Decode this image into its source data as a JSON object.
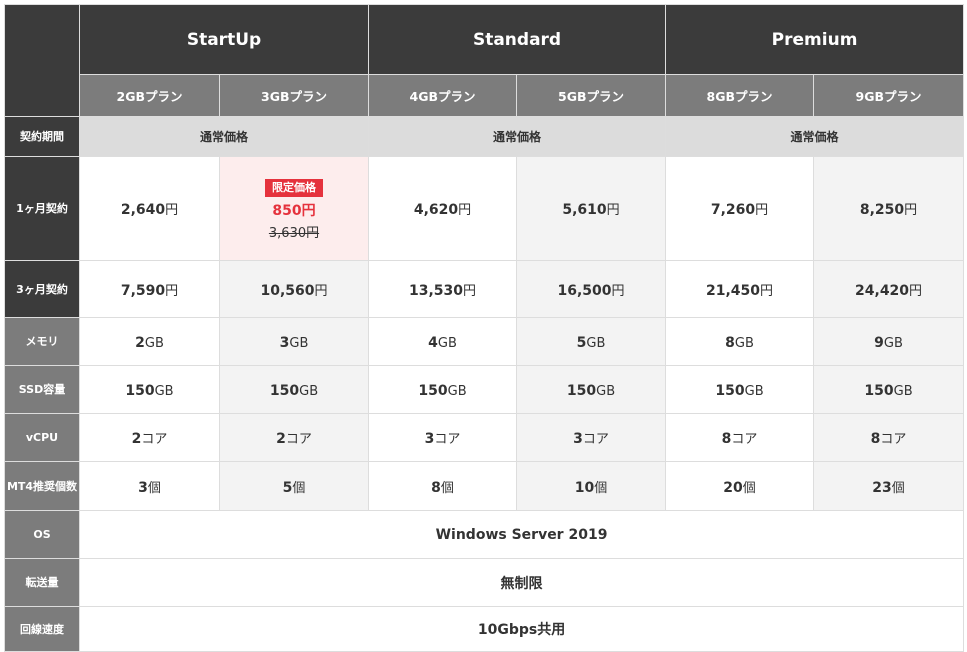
{
  "tiers": [
    "StartUp",
    "Standard",
    "Premium"
  ],
  "plans": [
    "2GBプラン",
    "3GBプラン",
    "4GBプラン",
    "5GBプラン",
    "8GBプラン",
    "9GBプラン"
  ],
  "labels": {
    "contract": "契約期間",
    "one_month": "1ヶ月契約",
    "three_month": "3ヶ月契約",
    "memory": "メモリ",
    "ssd": "SSD容量",
    "vcpu": "vCPU",
    "mt4": "MT4推奨個数",
    "os": "OS",
    "transfer": "転送量",
    "line_speed": "回線速度"
  },
  "normal_price_label": "通常価格",
  "currency": "円",
  "one_month": [
    "2,640",
    "850",
    "4,620",
    "5,610",
    "7,260",
    "8,250"
  ],
  "promo": {
    "badge": "限定価格",
    "old_price": "3,630円"
  },
  "three_month": [
    "7,590",
    "10,560",
    "13,530",
    "16,500",
    "21,450",
    "24,420"
  ],
  "memory": {
    "values": [
      "2",
      "3",
      "4",
      "5",
      "8",
      "9"
    ],
    "unit": "GB"
  },
  "ssd": {
    "values": [
      "150",
      "150",
      "150",
      "150",
      "150",
      "150"
    ],
    "unit": "GB"
  },
  "vcpu": {
    "values": [
      "2",
      "2",
      "3",
      "3",
      "8",
      "8"
    ],
    "unit": "コア"
  },
  "mt4": {
    "values": [
      "3",
      "5",
      "8",
      "10",
      "20",
      "23"
    ],
    "unit": "個"
  },
  "os": "Windows Server 2019",
  "transfer": "無制限",
  "line_speed": "10Gbps共用",
  "colors": {
    "dark": "#3b3b3b",
    "gray": "#7c7c7c",
    "light": "#dcdcdc",
    "alt": "#f3f3f3",
    "accent": "#e5323d",
    "promo_bg": "#fdeded"
  }
}
